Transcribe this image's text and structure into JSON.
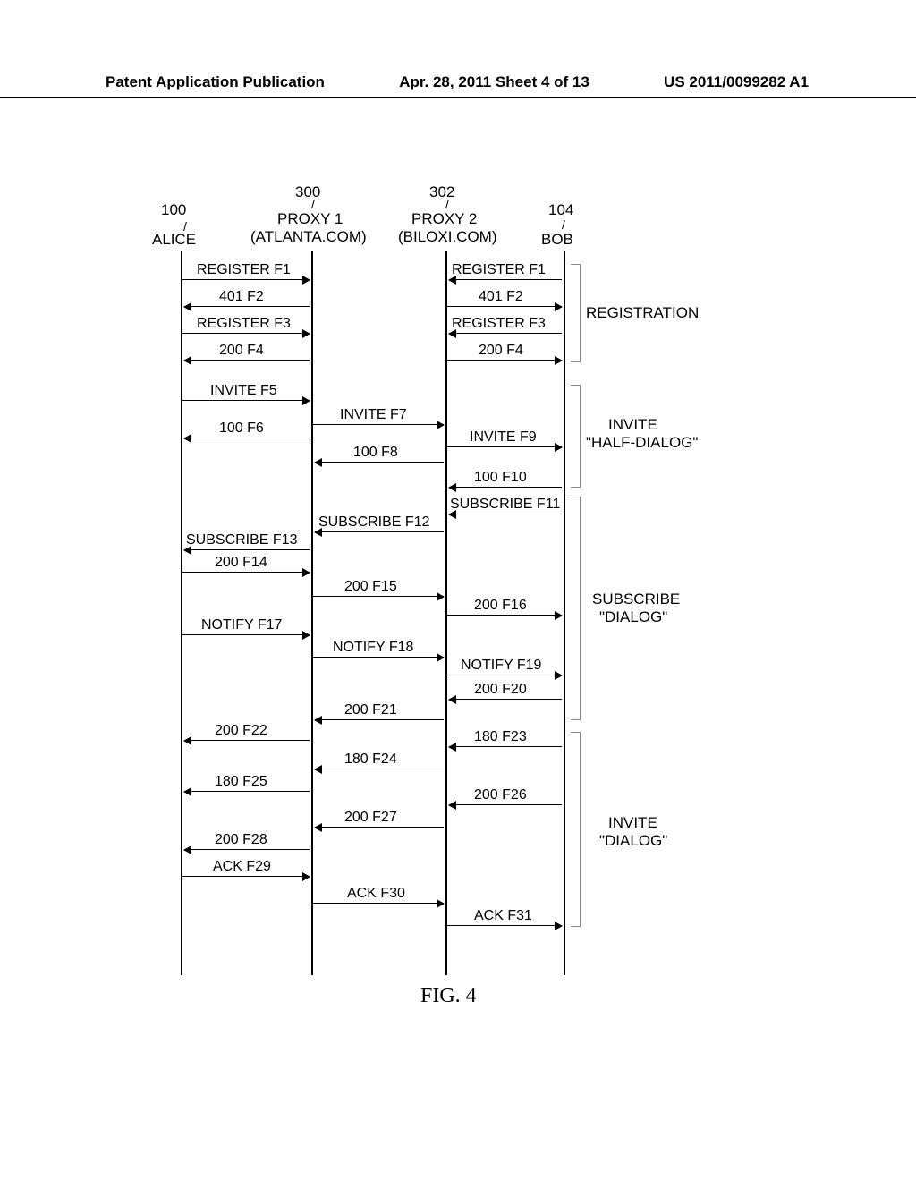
{
  "header": {
    "left": "Patent Application Publication",
    "center": "Apr. 28, 2011  Sheet 4 of 13",
    "right": "US 2011/0099282 A1"
  },
  "actors": {
    "alice": {
      "ref": "100",
      "name": "ALICE"
    },
    "proxy1": {
      "ref": "300",
      "name": "PROXY 1",
      "sub": "(ATLANTA.COM)"
    },
    "proxy2": {
      "ref": "302",
      "name": "PROXY 2",
      "sub": "(BILOXI.COM)"
    },
    "bob": {
      "ref": "104",
      "name": "BOB"
    }
  },
  "messages": {
    "m1a": "REGISTER F1",
    "m1b": "REGISTER F1",
    "m2a": "401 F2",
    "m2b": "401 F2",
    "m3a": "REGISTER F3",
    "m3b": "REGISTER F3",
    "m4a": "200 F4",
    "m4b": "200 F4",
    "m5": "INVITE F5",
    "m6": "100 F6",
    "m7": "INVITE F7",
    "m8": "100 F8",
    "m9": "INVITE F9",
    "m10": "100 F10",
    "m11": "SUBSCRIBE F11",
    "m12": "SUBSCRIBE F12",
    "m13": "SUBSCRIBE F13",
    "m14": "200 F14",
    "m15": "200 F15",
    "m16": "200 F16",
    "m17": "NOTIFY F17",
    "m18": "NOTIFY F18",
    "m19": "NOTIFY F19",
    "m20": "200 F20",
    "m21": "200 F21",
    "m22": "200 F22",
    "m23": "180 F23",
    "m24": "180 F24",
    "m25": "180 F25",
    "m26": "200 F26",
    "m27": "200 F27",
    "m28": "200 F28",
    "m29": "ACK F29",
    "m30": "ACK F30",
    "m31": "ACK F31"
  },
  "phases": {
    "p1": "REGISTRATION",
    "p2a": "INVITE",
    "p2b": "\"HALF-DIALOG\"",
    "p3a": "SUBSCRIBE",
    "p3b": "\"DIALOG\"",
    "p4a": "INVITE",
    "p4b": "\"DIALOG\""
  },
  "caption": "FIG. 4"
}
